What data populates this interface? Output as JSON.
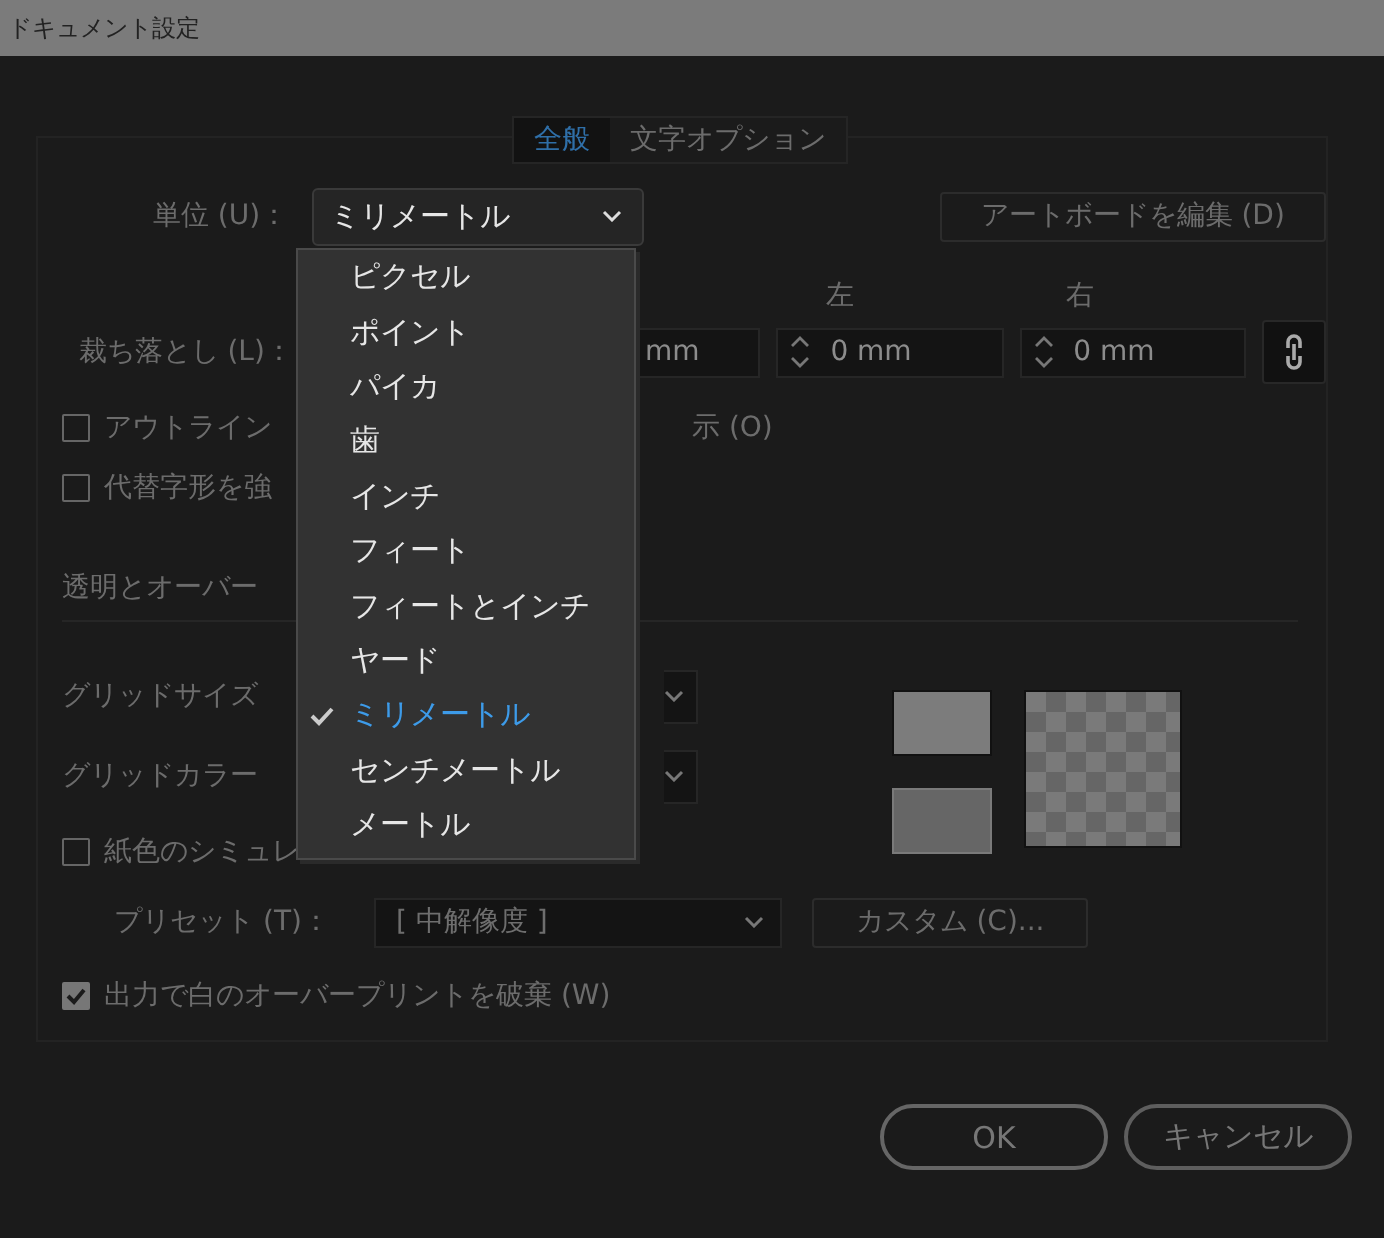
{
  "window": {
    "title": "ドキュメント設定"
  },
  "tabs": [
    {
      "label": "全般",
      "selected": true
    },
    {
      "label": "文字オプション",
      "selected": false
    }
  ],
  "units": {
    "label": "単位 (U)：",
    "value": "ミリメートル",
    "expanded": true,
    "options": [
      {
        "label": "ピクセル",
        "selected": false
      },
      {
        "label": "ポイント",
        "selected": false
      },
      {
        "label": "パイカ",
        "selected": false
      },
      {
        "label": "歯",
        "selected": false
      },
      {
        "label": "インチ",
        "selected": false
      },
      {
        "label": "フィート",
        "selected": false
      },
      {
        "label": "フィートとインチ",
        "selected": false
      },
      {
        "label": "ヤード",
        "selected": false
      },
      {
        "label": "ミリメートル",
        "selected": true
      },
      {
        "label": "センチメートル",
        "selected": false
      },
      {
        "label": "メートル",
        "selected": false
      }
    ]
  },
  "edit_artboards_button": "アートボードを編集 (D)",
  "bleed": {
    "label": "裁ち落とし (L)：",
    "fields": [
      {
        "value": "mm"
      },
      {
        "label": "左",
        "value": "0 mm"
      },
      {
        "label": "右",
        "value": "0 mm"
      }
    ]
  },
  "checkboxes": [
    {
      "label": "アウトライン",
      "label_end": "示 (O)",
      "checked": false
    },
    {
      "label": "代替字形を強",
      "checked": false
    }
  ],
  "transparency": {
    "title": "透明とオーバー",
    "grid_size_label": "グリッドサイズ",
    "grid_color_label": "グリッドカラー",
    "simulate_paper": {
      "label": "紙色のシミュレ",
      "checked": false
    },
    "preset": {
      "label": "プリセット (T)：",
      "value": "[ 中解像度 ]"
    },
    "custom_button": "カスタム (C)...",
    "discard_white_overprint": {
      "label": "出力で白のオーバープリントを破棄 (W)",
      "checked": true
    }
  },
  "buttons": [
    {
      "label": "OK",
      "kind": "primary"
    },
    {
      "label": "キャンセル",
      "kind": "secondary"
    }
  ]
}
